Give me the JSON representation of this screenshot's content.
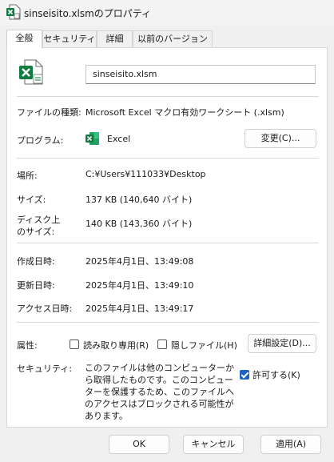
{
  "window": {
    "title": "sinseisito.xlsmのプロパティ"
  },
  "tabs": [
    {
      "label": "全般",
      "active": true
    },
    {
      "label": "セキュリティ",
      "active": false
    },
    {
      "label": "詳細",
      "active": false
    },
    {
      "label": "以前のバージョン",
      "active": false
    }
  ],
  "general": {
    "filename": "sinseisito.xlsm",
    "file_type_label": "ファイルの種類:",
    "file_type_value": "Microsoft Excel マクロ有効ワークシート (.xlsm)",
    "program_label": "プログラム:",
    "program_value": "Excel",
    "change_button": "変更(C)...",
    "location_label": "場所:",
    "location_value": "C:¥Users¥111033¥Desktop",
    "size_label": "サイズ:",
    "size_value": "137 KB (140,640 バイト)",
    "disk_size_label_line1": "ディスク上",
    "disk_size_label_line2": "のサイズ:",
    "disk_size_value": "140 KB (143,360 バイト)",
    "created_label": "作成日時:",
    "created_value": "2025年4月1日、13:49:08",
    "modified_label": "更新日時:",
    "modified_value": "2025年4月1日、13:49:10",
    "accessed_label": "アクセス日時:",
    "accessed_value": "2025年4月1日、13:49:17",
    "attributes_label": "属性:",
    "readonly_label": "読み取り専用(R)",
    "readonly_checked": false,
    "hidden_label": "隠しファイル(H)",
    "hidden_checked": false,
    "advanced_button": "詳細設定(D)...",
    "security_label": "セキュリティ:",
    "security_text": "このファイルは他のコンピューターから取得したものです。このコンピューターを保護するため、このファイルへのアクセスはブロックされる可能性があります。",
    "unblock_label": "許可する(K)",
    "unblock_checked": true
  },
  "footer": {
    "ok": "OK",
    "cancel": "キャンセル",
    "apply": "適用(A)"
  },
  "colors": {
    "excel_green": "#107c41",
    "accent_blue": "#1e63c2"
  }
}
